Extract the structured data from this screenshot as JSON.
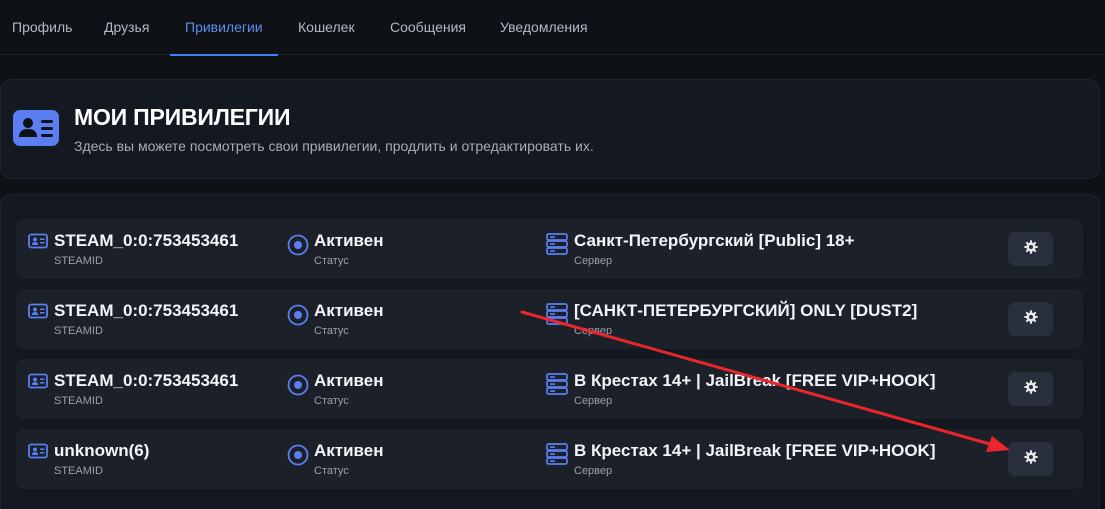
{
  "tabs": [
    {
      "label": "Профиль",
      "active": false
    },
    {
      "label": "Друзья",
      "active": false
    },
    {
      "label": "Привилегии",
      "active": true
    },
    {
      "label": "Кошелек",
      "active": false
    },
    {
      "label": "Сообщения",
      "active": false
    },
    {
      "label": "Уведомления",
      "active": false
    }
  ],
  "header": {
    "icon": "id-card-icon",
    "title": "МОИ ПРИВИЛЕГИИ",
    "description": "Здесь вы можете посмотреть свои привилегии, продлить и отредактировать их."
  },
  "privileges": [
    {
      "steamid": "STEAM_0:0:753453461",
      "steamid_label": "STEAMID",
      "status": "Активен",
      "status_label": "Статус",
      "server": "Санкт-Петербургский [Public] 18+",
      "server_label": "Сервер"
    },
    {
      "steamid": "STEAM_0:0:753453461",
      "steamid_label": "STEAMID",
      "status": "Активен",
      "status_label": "Статус",
      "server": "[САНКТ-ПЕТЕРБУРГСКИЙ] ONLY [DUST2]",
      "server_label": "Сервер"
    },
    {
      "steamid": "STEAM_0:0:753453461",
      "steamid_label": "STEAMID",
      "status": "Активен",
      "status_label": "Статус",
      "server": "В Крестах 14+ | JailBreak [FREE VIP+HOOK]",
      "server_label": "Сервер"
    },
    {
      "steamid": "unknown(6)",
      "steamid_label": "STEAMID",
      "status": "Активен",
      "status_label": "Статус",
      "server": "В Крестах 14+ | JailBreak [FREE VIP+HOOK]",
      "server_label": "Сервер"
    }
  ],
  "icons": {
    "steamid": "id-card-icon",
    "status": "radio-dot-icon",
    "server": "server-icon",
    "settings": "gear-icon"
  },
  "colors": {
    "accent": "#5b8ef0",
    "icon_blue": "#5b7ff2",
    "annotation_arrow": "#e8262b"
  }
}
